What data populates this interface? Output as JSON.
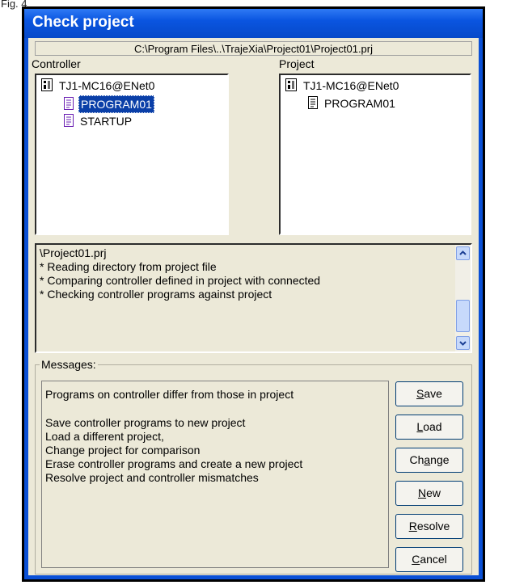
{
  "caption": "Fig. 4",
  "window": {
    "title": "Check project"
  },
  "path": "C:\\Program Files\\..\\TrajeXia\\Project01\\Project01.prj",
  "controller": {
    "label": "Controller",
    "root": "TJ1-MC16@ENet0",
    "items": [
      "PROGRAM01",
      "STARTUP"
    ],
    "selected": "PROGRAM01"
  },
  "project": {
    "label": "Project",
    "root": "TJ1-MC16@ENet0",
    "items": [
      "PROGRAM01"
    ]
  },
  "log": {
    "lines": [
      "\\Project01.prj",
      "* Reading directory from project file",
      "* Comparing controller defined in project with connected",
      "* Checking controller programs against project"
    ]
  },
  "messages": {
    "label": "Messages:",
    "lines": [
      "Programs on controller differ from those in project",
      "",
      "Save controller programs to new project",
      "Load a different project,",
      "Change project for comparison",
      "Erase controller programs and create a new project",
      "Resolve project and controller mismatches"
    ]
  },
  "buttons": {
    "save": {
      "first": "S",
      "rest": "ave"
    },
    "load": {
      "first": "L",
      "rest": "oad"
    },
    "change_a": "Ch",
    "change_u": "a",
    "change_b": "nge",
    "new": {
      "first": "N",
      "rest": "ew"
    },
    "resolve": {
      "first": "R",
      "rest": "esolve"
    },
    "cancel": {
      "first": "C",
      "rest": "ancel"
    }
  }
}
